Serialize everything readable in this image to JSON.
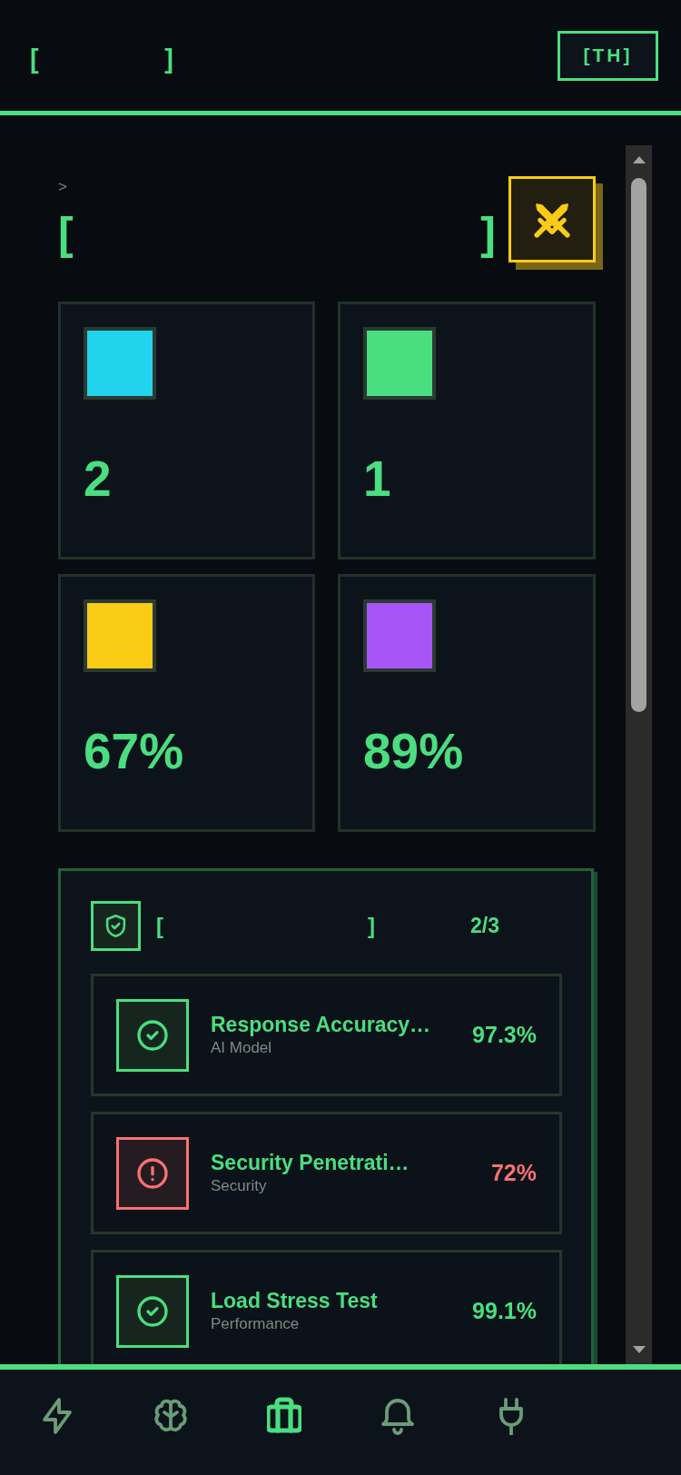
{
  "header": {
    "title": {
      "open": "[",
      "close": "]"
    },
    "language_button": "[TH]"
  },
  "hero": {
    "prompt": ">",
    "title": {
      "open": "[",
      "close": "]"
    }
  },
  "stats": [
    {
      "color": "#22d3ee",
      "value": "2"
    },
    {
      "color": "#4ade80",
      "value": "1"
    },
    {
      "color": "#facc15",
      "value": "67%"
    },
    {
      "color": "#a855f7",
      "value": "89%"
    }
  ],
  "tests": {
    "title": {
      "open": "[",
      "close": "]"
    },
    "count": "2/3",
    "items": [
      {
        "name": "Response Accuracy…",
        "category": "AI Model",
        "score": "97.3%",
        "passed": true
      },
      {
        "name": "Security Penetrati…",
        "category": "Security",
        "score": "72%",
        "passed": false
      },
      {
        "name": "Load Stress Test",
        "category": "Performance",
        "score": "99.1%",
        "passed": true
      }
    ]
  },
  "nav": [
    {
      "kind": "bolt",
      "selected": false
    },
    {
      "kind": "brain",
      "selected": false
    },
    {
      "kind": "briefcase",
      "selected": true
    },
    {
      "kind": "bell",
      "selected": false
    },
    {
      "kind": "plug",
      "selected": false
    }
  ]
}
